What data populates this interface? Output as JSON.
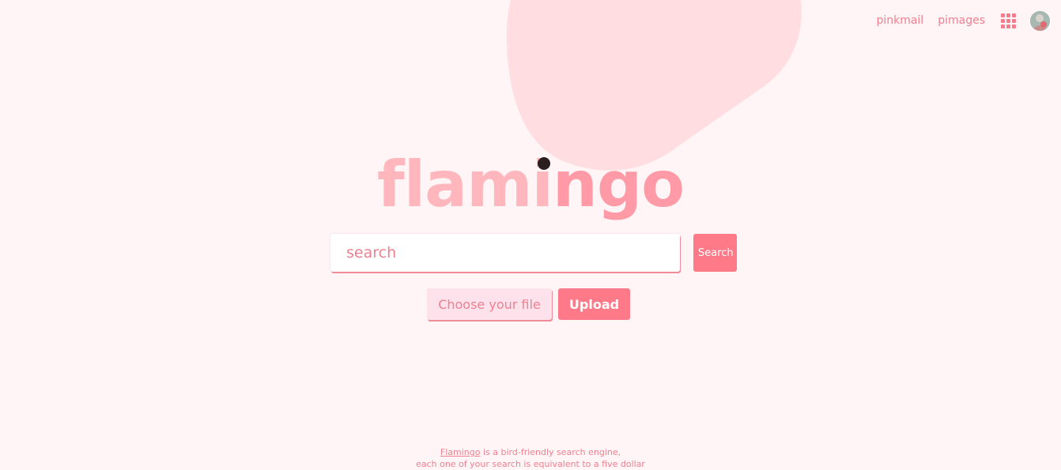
{
  "nav": {
    "mail_label": "pinkmail",
    "images_label": "pimages",
    "apps_icon": "grid-apps-icon",
    "avatar_icon": "user-avatar"
  },
  "logo": {
    "part1": "flami",
    "part2": "ngo"
  },
  "search": {
    "placeholder": "search",
    "value": "",
    "button_label": "Search"
  },
  "upload": {
    "choose_label": "Choose your file",
    "button_label": "Upload"
  },
  "footer": {
    "brand_link": "Flamingo",
    "line1_rest": " is a bird-friendly search engine,",
    "line2": "each one of your search is equivalent to a five dollar"
  },
  "colors": {
    "background": "#fff5f6",
    "accent": "#ff7a89",
    "text_pink": "#f07f8f",
    "blob": "#ffdde0"
  }
}
